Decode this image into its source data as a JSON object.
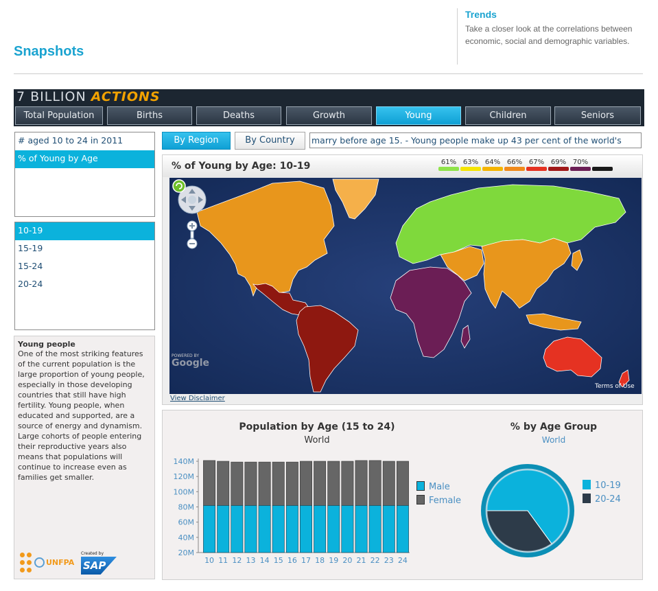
{
  "header": {
    "title": "Snapshots",
    "trends_title": "Trends",
    "trends_desc": "Take a closer look at the correlations between economic, social and demographic variables."
  },
  "banner": {
    "logo_part1": "7 BILLION",
    "logo_part2": "ACTIONS"
  },
  "nav": {
    "tabs": [
      "Total Population",
      "Births",
      "Deaths",
      "Growth",
      "Young",
      "Children",
      "Seniors"
    ],
    "active": "Young"
  },
  "metrics": {
    "items": [
      "# aged 10 to 24 in 2011",
      "% of Young by Age"
    ],
    "active": "% of Young by Age"
  },
  "age_groups": {
    "items": [
      "10-19",
      "15-19",
      "15-24",
      "20-24"
    ],
    "active": "10-19"
  },
  "description": {
    "title": "Young people",
    "body": "One of the most striking features of the current population is the large proportion of young people, especially in those developing countries that still have high fertility.  Young people, when educated and supported, are a source of energy and dynamism. Large cohorts of people entering their reproductive years also means that populations will continue to increase even as families get smaller."
  },
  "logos": {
    "unfpa": "UNFPA",
    "sap_caption": "Created by",
    "sap": "SAP"
  },
  "view_toggle": {
    "region": "By Region",
    "country": "By Country",
    "active": "By Region"
  },
  "ticker": {
    "text": "marry before age 15.   -   Young people make up 43 per cent of the world's"
  },
  "map": {
    "title": "% of Young by Age: 10-19",
    "legend": [
      {
        "label": "61%",
        "color": "#8fe34a"
      },
      {
        "label": "63%",
        "color": "#f5e400"
      },
      {
        "label": "64%",
        "color": "#f5b400"
      },
      {
        "label": "66%",
        "color": "#f08a1c"
      },
      {
        "label": "67%",
        "color": "#e53222"
      },
      {
        "label": "69%",
        "color": "#a01818"
      },
      {
        "label": "70%",
        "color": "#6b1e55"
      },
      {
        "label": "",
        "color": "#1a1a1a"
      }
    ],
    "disclaimer": "View Disclaimer",
    "terms": "Terms of Use",
    "powered_by": "POWERED BY",
    "google": "Google"
  },
  "chart_data": [
    {
      "type": "bar",
      "title": "Population by Age (15 to 24)",
      "subtitle": "World",
      "categories": [
        "10",
        "11",
        "12",
        "13",
        "14",
        "15",
        "16",
        "17",
        "18",
        "19",
        "20",
        "21",
        "22",
        "23",
        "24"
      ],
      "series": [
        {
          "name": "Male",
          "color": "#0bb2dc",
          "values": [
            62,
            62,
            62,
            62,
            62,
            62,
            62,
            62,
            62,
            62,
            62,
            62,
            62,
            62,
            62
          ]
        },
        {
          "name": "Female",
          "color": "#666666",
          "values": [
            59,
            58,
            57,
            57,
            57,
            57,
            57,
            58,
            58,
            58,
            58,
            59,
            59,
            58,
            58
          ]
        }
      ],
      "ylim": [
        20,
        140
      ],
      "yticks": [
        "20M",
        "40M",
        "60M",
        "80M",
        "100M",
        "120M",
        "140M"
      ],
      "stacked": true,
      "legend": "right"
    },
    {
      "type": "pie",
      "title": "% by Age Group",
      "subtitle": "World",
      "slices": [
        {
          "label": "10-19",
          "value": 65,
          "color": "#0bb2dc"
        },
        {
          "label": "20-24",
          "value": 35,
          "color": "#2d3b49"
        }
      ],
      "legend": "right"
    }
  ]
}
